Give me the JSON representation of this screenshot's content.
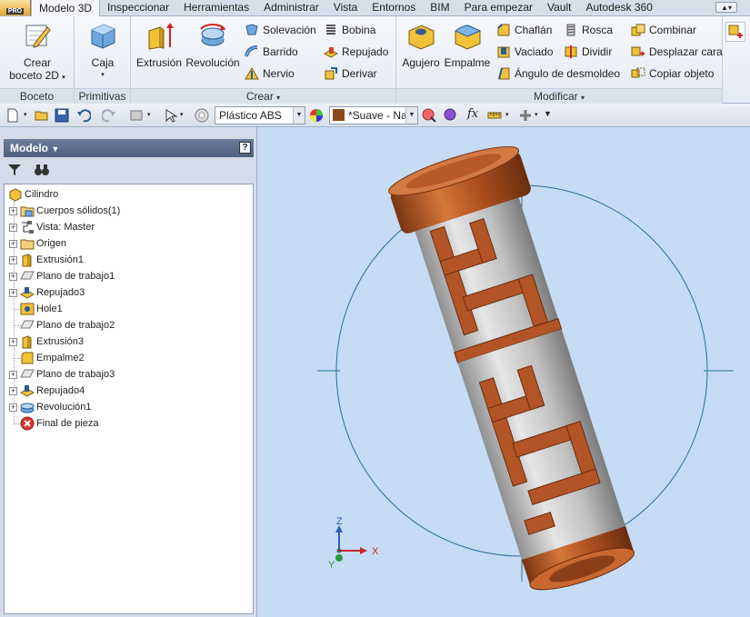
{
  "app": {
    "badge": "PRO"
  },
  "tabs": [
    "Modelo 3D",
    "Inspeccionar",
    "Herramientas",
    "Administrar",
    "Vista",
    "Entornos",
    "BIM",
    "Para empezar",
    "Vault",
    "Autodesk 360"
  ],
  "ribbon": {
    "boceto": {
      "title": "Boceto",
      "crear_line1": "Crear",
      "crear_line2": "boceto 2D"
    },
    "primitivas": {
      "title": "Primitivas",
      "caja": "Caja"
    },
    "crear": {
      "title": "Crear",
      "extrusion": "Extrusión",
      "revolucion": "Revolución",
      "solevacion": "Solevación",
      "barrido": "Barrido",
      "nervio": "Nervio",
      "bobina": "Bobina",
      "repujado": "Repujado",
      "derivar": "Derivar"
    },
    "modificar": {
      "title": "Modificar",
      "agujero": "Agujero",
      "empalme": "Empalme",
      "chaflan": "Chaflán",
      "rosca": "Rosca",
      "vaciado": "Vaciado",
      "dividir": "Dividir",
      "angulo": "Ángulo de desmoldeo",
      "combinar": "Combinar",
      "desplazar": "Desplazar cara",
      "copiar": "Copiar objeto"
    }
  },
  "qat": {
    "material": "Plástico ABS",
    "appearance": "*Suave - Na"
  },
  "browser": {
    "title": "Modelo",
    "help": "?",
    "root": "Cilindro",
    "nodes": [
      {
        "label": "Cuerpos sólidos(1)",
        "expandable": true
      },
      {
        "label": "Vista: Master",
        "expandable": true
      },
      {
        "label": "Origen",
        "expandable": true
      },
      {
        "label": "Extrusión1",
        "expandable": true
      },
      {
        "label": "Plano de trabajo1",
        "expandable": true
      },
      {
        "label": "Repujado3",
        "expandable": true
      },
      {
        "label": "Hole1",
        "expandable": false
      },
      {
        "label": "Plano de trabajo2",
        "expandable": false
      },
      {
        "label": "Extrusión3",
        "expandable": true
      },
      {
        "label": "Empalme2",
        "expandable": false
      },
      {
        "label": "Plano de trabajo3",
        "expandable": true
      },
      {
        "label": "Repujado4",
        "expandable": true
      },
      {
        "label": "Revolución1",
        "expandable": true
      },
      {
        "label": "Final de pieza",
        "expandable": false
      }
    ]
  },
  "viewport": {
    "axis_x": "X",
    "axis_y": "Y",
    "axis_z": "Z"
  },
  "colors": {
    "copper": "#c8642a",
    "silver": "#c9c9c9",
    "viewport_bg": "#c5dcf4",
    "circle": "#2a6e9a"
  }
}
